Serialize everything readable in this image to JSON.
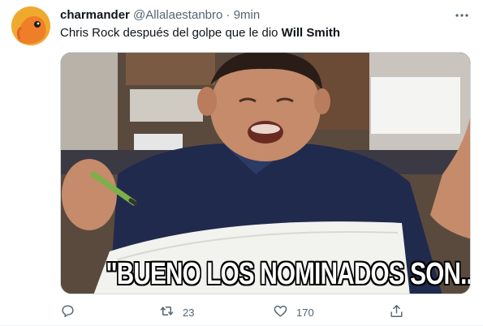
{
  "tweet": {
    "display_name": "charmander",
    "handle": "@Allalaestanbro",
    "separator": "·",
    "time": "9min",
    "text_prefix": "Chris Rock después del golpe que le dio ",
    "text_bold": "Will Smith",
    "media": {
      "caption": "\"BUENO LOS NOMINADOS SON...\""
    },
    "actions": {
      "reply_icon": "reply-icon",
      "retweet_icon": "retweet-icon",
      "retweet_count": "23",
      "like_icon": "heart-icon",
      "like_count": "170",
      "share_icon": "share-icon"
    }
  }
}
